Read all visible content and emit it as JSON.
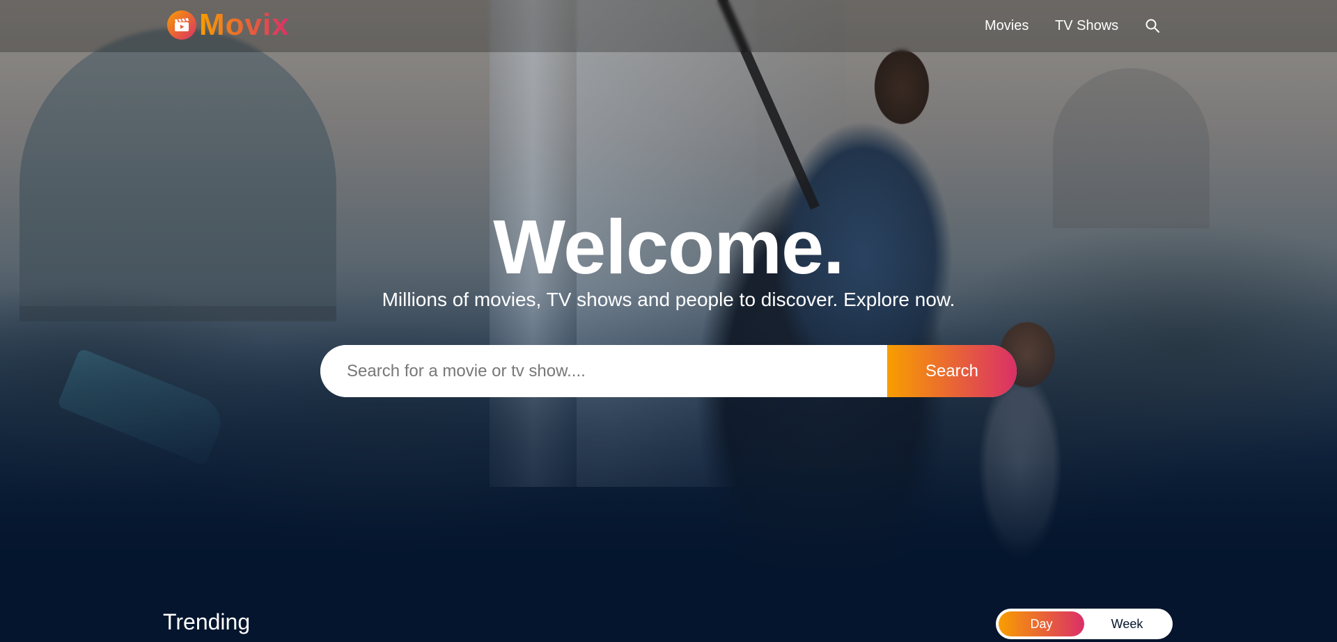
{
  "brand": {
    "name": "Movix",
    "icon": "clapperboard-play-icon"
  },
  "nav": {
    "items": [
      {
        "label": "Movies"
      },
      {
        "label": "TV Shows"
      }
    ],
    "search_icon": "search-icon"
  },
  "hero": {
    "title": "Welcome.",
    "subtitle": "Millions of movies, TV shows and people to discover. Explore now.",
    "search": {
      "placeholder": "Search for a movie or tv show....",
      "value": "",
      "button_label": "Search"
    }
  },
  "trending": {
    "title": "Trending",
    "tabs": [
      {
        "label": "Day",
        "active": true
      },
      {
        "label": "Week",
        "active": false
      }
    ]
  },
  "colors": {
    "background": "#04152d",
    "gradient_start": "#f89e00",
    "gradient_end": "#da2f68"
  }
}
